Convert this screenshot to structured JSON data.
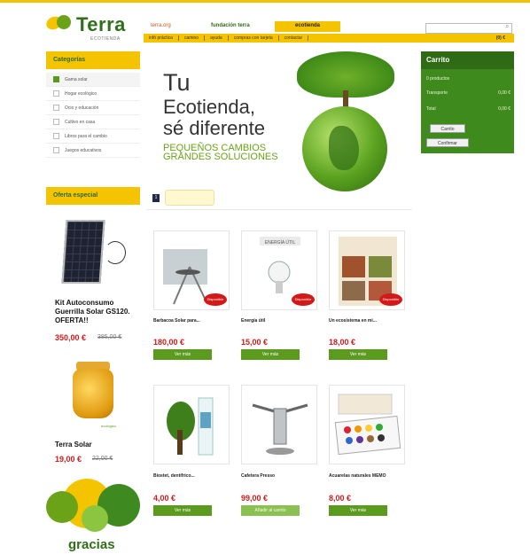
{
  "header": {
    "brand": "Terra",
    "brand_sub": "ECOTIENDA",
    "tabs": [
      "terra.org",
      "fundación terra",
      "ecotienda"
    ],
    "menu": [
      "infó práctica",
      "camino",
      "ayuda",
      "compras con tarjeta",
      "contactar"
    ],
    "cart_mini": "(0) €"
  },
  "sidebar": {
    "categories_title": "Categorías",
    "categories": [
      "Gama solar",
      "Hogar ecológico",
      "Ocio y educación",
      "Cultivo en casa",
      "Libros para el cambio",
      "Juegos educativos"
    ],
    "offer_title": "Oferta especial",
    "offer1": {
      "title": "Kit Autoconsumo Guerrilla Solar GS120. OFERTA!!",
      "price": "350,00 €",
      "old": "385,00 €"
    },
    "offer2": {
      "tag": "ecológico",
      "title": "Terra Solar",
      "price": "19,00 €",
      "old": "22,00 €"
    },
    "gracias": "gracias"
  },
  "banner": {
    "line1": "Tu",
    "line2": "Ecotienda,",
    "line3": "sé diferente",
    "line4": "PEQUEÑOS CAMBIOS GRANDES SOLUCIONES"
  },
  "cart": {
    "title": "Carrito",
    "empty": "0 productos",
    "shipping_label": "Transporte",
    "shipping_value": "0,00 €",
    "total_label": "Total",
    "total_value": "0,00 €",
    "btn_cart": "Carrito",
    "btn_confirm": "Confirmar"
  },
  "products": [
    {
      "title": "Barbacoa Solar para...",
      "price": "180,00 €",
      "button": "Ver más",
      "badge": "Disponible"
    },
    {
      "title": "Energía útil",
      "price": "15,00 €",
      "button": "Ver más",
      "badge": "Disponible"
    },
    {
      "title": "Un ecosistema en mi...",
      "price": "18,00 €",
      "button": "Ver más",
      "badge": "Disponible"
    },
    {
      "title": "Biostet, dentífrico...",
      "price": "4,00 €",
      "button": "Ver más"
    },
    {
      "title": "Cafetera Presso",
      "price": "99,00 €",
      "button": "Añadir al carrito"
    },
    {
      "title": "Acuarelas naturales MEMO",
      "price": "8,00 €",
      "button": "Ver más"
    }
  ],
  "book_label": "ENERGÍA ÚTIL"
}
